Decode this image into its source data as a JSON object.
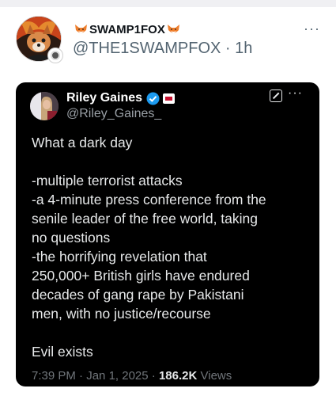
{
  "post": {
    "display_name": "SWAMP1FOX",
    "handle": "@THE1SWAMPFOX",
    "separator": "·",
    "time": "1h",
    "more_label": "···"
  },
  "quoted": {
    "display_name": "Riley Gaines",
    "handle": "@Riley_Gaines_",
    "more_label": "···",
    "lines": [
      "What a dark day",
      "",
      "-multiple terrorist attacks",
      "-a 4-minute press conference from the",
      "senile leader of the free world, taking",
      "no questions",
      "-the horrifying revelation that",
      "250,000+ British girls have endured",
      "decades of gang rape by Pakistani",
      "men, with no justice/recourse",
      "",
      "Evil exists"
    ],
    "meta": {
      "time": "7:39 PM",
      "date": "Jan 1, 2025",
      "separator": "·",
      "views_count": "186.2K",
      "views_label": "Views"
    }
  },
  "icons": [
    "fox-emoji-icon",
    "verified-badge-icon",
    "flag-badge-icon",
    "grok-edit-icon",
    "more-options-icon"
  ],
  "colors": {
    "card_bg": "#000000",
    "verified_blue": "#1d9bf0",
    "muted_text": "#536471",
    "card_text": "#e7e9ea"
  }
}
